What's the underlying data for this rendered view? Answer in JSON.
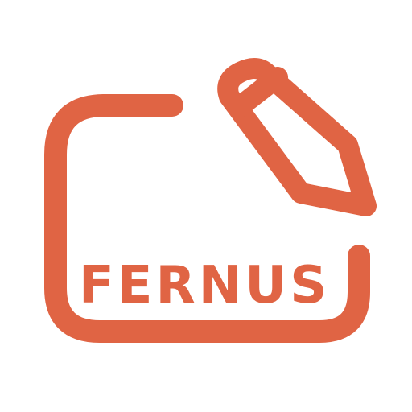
{
  "logo": {
    "wordmark": "FERNUS",
    "color": "#e06444",
    "background": "#ffffff",
    "icon": "pencil-on-board-icon"
  }
}
